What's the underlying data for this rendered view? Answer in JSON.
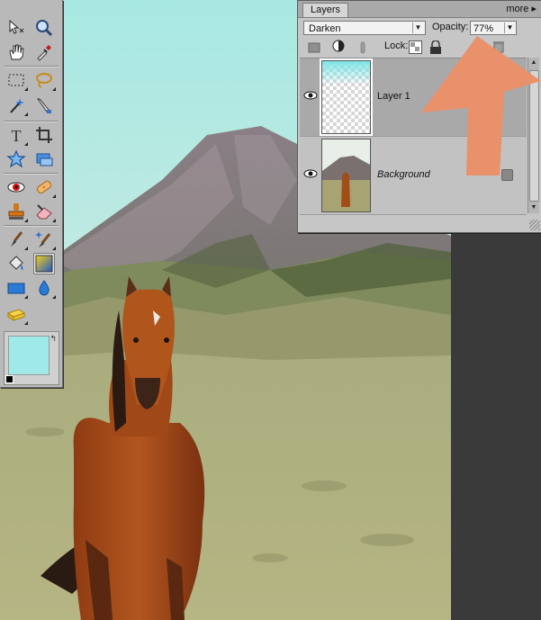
{
  "toolbox": {
    "tools": [
      {
        "name": "move-tool-icon"
      },
      {
        "name": "zoom-tool-icon"
      },
      {
        "name": "hand-tool-icon"
      },
      {
        "name": "eyedropper-tool-icon"
      },
      {
        "name": "marquee-tool-icon"
      },
      {
        "name": "lasso-tool-icon"
      },
      {
        "name": "magic-wand-tool-icon"
      },
      {
        "name": "selection-brush-tool-icon"
      },
      {
        "name": "type-tool-icon"
      },
      {
        "name": "crop-tool-icon"
      },
      {
        "name": "cookie-cutter-tool-icon"
      },
      {
        "name": "straighten-tool-icon"
      },
      {
        "name": "red-eye-tool-icon"
      },
      {
        "name": "healing-brush-tool-icon"
      },
      {
        "name": "clone-stamp-tool-icon"
      },
      {
        "name": "eraser-tool-icon"
      },
      {
        "name": "brush-tool-icon"
      },
      {
        "name": "smart-brush-tool-icon"
      },
      {
        "name": "paint-bucket-tool-icon"
      },
      {
        "name": "gradient-tool-icon"
      },
      {
        "name": "shape-tool-icon"
      },
      {
        "name": "blur-tool-icon"
      },
      {
        "name": "sponge-tool-icon"
      }
    ],
    "foreground_color": "#9feae8"
  },
  "layers_palette": {
    "tab_label": "Layers",
    "more_label": "more",
    "blend_mode": "Darken",
    "opacity_label": "Opacity:",
    "opacity_value": "77%",
    "lock_label": "Lock:",
    "layers": [
      {
        "name": "Layer 1",
        "selected": true,
        "visible": true
      },
      {
        "name": "Background",
        "selected": false,
        "visible": true
      }
    ]
  },
  "annotation": {
    "arrow_color": "#e9916a"
  }
}
